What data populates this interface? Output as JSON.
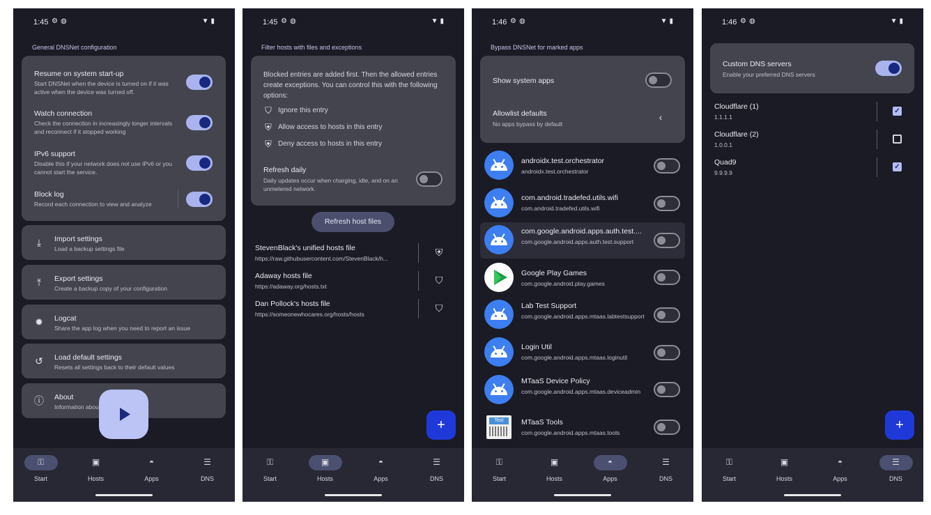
{
  "screen1": {
    "status_time": "1:45",
    "section_title": "General DNSNet configuration",
    "settings": [
      {
        "title": "Resume on system start-up",
        "subtitle": "Start DNSNet when the device is turned on if it was active when the device was turned off.",
        "on": true
      },
      {
        "title": "Watch connection",
        "subtitle": "Check the connection in increasingly longer intervals and reconnect if it stopped working",
        "on": true
      },
      {
        "title": "IPv6 support",
        "subtitle": "Disable this if your network does not use IPv6 or you cannot start the service.",
        "on": true
      },
      {
        "title": "Block log",
        "subtitle": "Record each connection to view and analyze",
        "on": true
      }
    ],
    "actions": [
      {
        "title": "Import settings",
        "subtitle": "Load a backup settings file",
        "icon": "download-icon"
      },
      {
        "title": "Export settings",
        "subtitle": "Create a backup copy of your configuration",
        "icon": "upload-icon"
      },
      {
        "title": "Logcat",
        "subtitle": "Share the app log when you need to report an issue",
        "icon": "bug-icon"
      },
      {
        "title": "Load default settings",
        "subtitle": "Resets all settings back to their default values",
        "icon": "history-icon"
      },
      {
        "title": "About",
        "subtitle": "Information about",
        "icon": "info-icon"
      }
    ]
  },
  "screen2": {
    "status_time": "1:45",
    "section_title": "Filter hosts with files and exceptions",
    "info_text": "Blocked entries are added first. Then the allowed entries create exceptions. You can control this with the following options:",
    "options": [
      "Ignore this entry",
      "Allow access to hosts in this entry",
      "Deny access to hosts in this entry"
    ],
    "refresh_daily_title": "Refresh daily",
    "refresh_daily_subtitle": "Daily updates occur when charging, idle, and on an unmetered network.",
    "refresh_button": "Refresh host files",
    "hosts": [
      {
        "name": "StevenBlack's unified hosts file",
        "url": "https://raw.githubusercontent.com/StevenBlack/h..."
      },
      {
        "name": "Adaway hosts file",
        "url": "https://adaway.org/hosts.txt"
      },
      {
        "name": "Dan Pollock's hosts file",
        "url": "https://someonewhocares.org/hosts/hosts"
      }
    ]
  },
  "screen3": {
    "status_time": "1:46",
    "section_title": "Bypass DNSNet for marked apps",
    "show_system_apps": "Show system apps",
    "allowlist_title": "Allowlist defaults",
    "allowlist_subtitle": "No apps bypass by default",
    "apps": [
      {
        "name": "androidx.test.orchestrator",
        "pkg": "androidx.test.orchestrator",
        "icon": "android-icon"
      },
      {
        "name": "com.android.tradefed.utils.wifi",
        "pkg": "com.android.tradefed.utils.wifi",
        "icon": "android-icon"
      },
      {
        "name": "com.google.android.apps.auth.test....",
        "pkg": "com.google.android.apps.auth.test.support",
        "icon": "android-icon"
      },
      {
        "name": "Google Play Games",
        "pkg": "com.google.android.play.games",
        "icon": "play-games-icon"
      },
      {
        "name": "Lab Test Support",
        "pkg": "com.google.android.apps.mtaas.labtestsupport",
        "icon": "android-icon"
      },
      {
        "name": "Login Util",
        "pkg": "com.google.android.apps.mtaas.loginutil",
        "icon": "android-icon"
      },
      {
        "name": "MTaaS Device Policy",
        "pkg": "com.google.android.apps.mtaas.deviceadmin",
        "icon": "android-icon"
      },
      {
        "name": "MTaaS Tools",
        "pkg": "com.google.android.apps.mtaas.tools",
        "icon": "test-icon"
      }
    ]
  },
  "screen4": {
    "status_time": "1:46",
    "custom_dns_title": "Custom DNS servers",
    "custom_dns_subtitle": "Enable your preferred DNS servers",
    "servers": [
      {
        "name": "Cloudflare (1)",
        "ip": "1.1.1.1",
        "checked": true
      },
      {
        "name": "Cloudflare (2)",
        "ip": "1.0.0.1",
        "checked": false
      },
      {
        "name": "Quad9",
        "ip": "9.9.9.9",
        "checked": true
      }
    ]
  },
  "nav": {
    "start": "Start",
    "hosts": "Hosts",
    "apps": "Apps",
    "dns": "DNS"
  },
  "misc": {
    "test_icon_label": "Test"
  },
  "colors": {
    "toggle_on": "#a9b3ee",
    "card": "#43444e",
    "fab": "#1f39d9",
    "background": "#1a1b24"
  }
}
